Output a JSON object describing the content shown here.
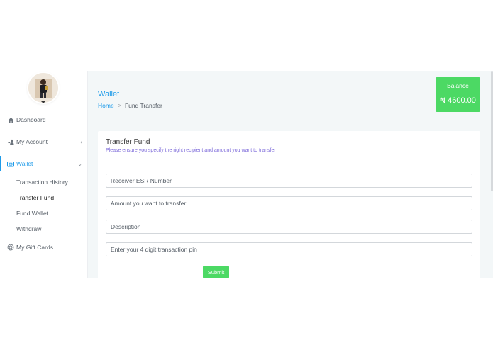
{
  "sidebar": {
    "avatar_icon": "user-avatar-photo",
    "items": [
      {
        "label": "Dashboard",
        "icon": "home-icon"
      },
      {
        "label": "My Account",
        "icon": "user-key-icon",
        "chevron": "‹"
      },
      {
        "label": "Wallet",
        "icon": "wallet-icon",
        "chevron": "⌄"
      },
      {
        "label": "My Gift Cards",
        "icon": "gift-card-icon"
      }
    ],
    "wallet_submenu": [
      "Transaction History",
      "Transfer Fund",
      "Fund Wallet",
      "Withdraw"
    ]
  },
  "header": {
    "title": "Wallet",
    "breadcrumb": {
      "home": "Home",
      "separator": ">",
      "current": "Fund Transfer"
    }
  },
  "balance": {
    "label": "Balance",
    "amount": "₦ 4600.00"
  },
  "form": {
    "title": "Transfer Fund",
    "subtitle": "Please ensure you specify the right recipient and amount you want to transfer",
    "fields": [
      {
        "placeholder": "Receiver ESR Number",
        "value": ""
      },
      {
        "placeholder": "Amount you want to transfer",
        "value": ""
      },
      {
        "placeholder": "Description",
        "value": ""
      },
      {
        "placeholder": "Enter your 4 digit transaction pin",
        "value": ""
      }
    ],
    "submit_label": "Submit"
  },
  "colors": {
    "accent": "#1e9be9",
    "success": "#4cd964",
    "subtitle": "#7b68d9",
    "content_bg": "#f3f7f8"
  }
}
